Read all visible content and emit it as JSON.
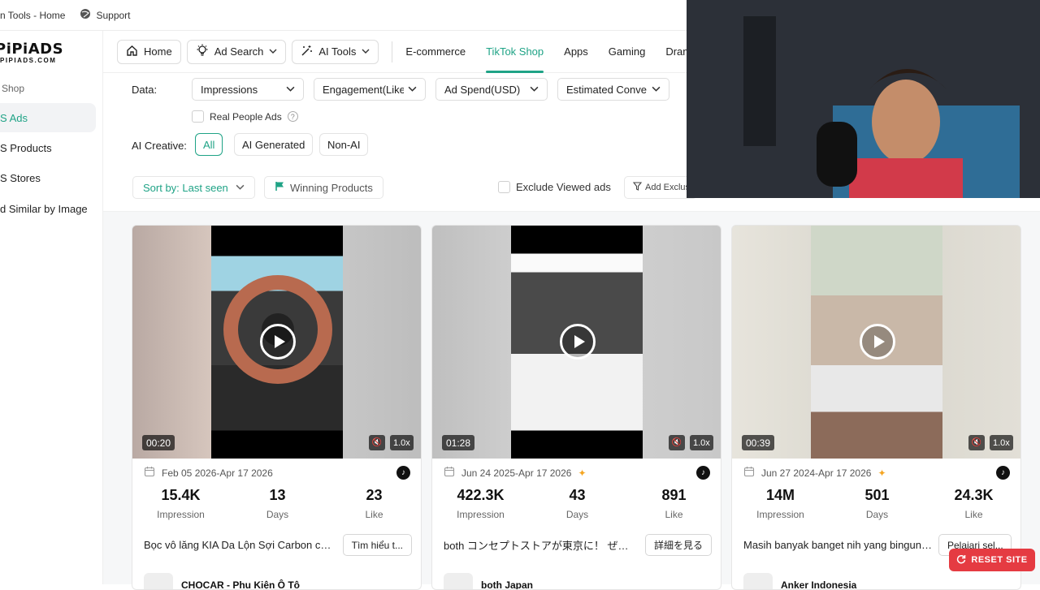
{
  "topbar": {
    "tools_link": "n Tools - Home",
    "support_link": "Support"
  },
  "logo": {
    "line1": "PiPiADS",
    "line2": "PIPIADS.COM"
  },
  "sidebar": {
    "group_label": "Shop",
    "items": [
      {
        "label": "S Ads",
        "active": true
      },
      {
        "label": "S Products",
        "active": false
      },
      {
        "label": "S Stores",
        "active": false
      },
      {
        "label": "d Similar by Image",
        "active": false
      }
    ]
  },
  "nav": {
    "home": "Home",
    "ad_search": "Ad Search",
    "ai_tools": "AI Tools",
    "links": [
      "E-commerce",
      "TikTok Shop",
      "Apps",
      "Gaming",
      "Drama"
    ],
    "active_link": "TikTok Shop"
  },
  "filters": {
    "data_label": "Data:",
    "dropdowns": [
      "Impressions",
      "Engagement(Like",
      "Ad Spend(USD)",
      "Estimated Conve"
    ],
    "real_people": "Real People Ads",
    "ai_creative_label": "AI Creative:",
    "ai_options": [
      "All",
      "AI Generated",
      "Non-AI"
    ],
    "sort_by": "Sort by: Last seen",
    "winning": "Winning Products",
    "exclude_viewed": "Exclude Viewed ads",
    "add_exclusion": "Add Exclus"
  },
  "cards": [
    {
      "duration": "00:20",
      "speed": "1.0x",
      "date_range": "Feb 05 2026-Apr 17 2026",
      "sparkle": false,
      "stats": [
        {
          "value": "15.4K",
          "label": "Impression"
        },
        {
          "value": "13",
          "label": "Days"
        },
        {
          "value": "23",
          "label": "Like"
        }
      ],
      "description": "Bọc vô lăng KIA Da Lộn Sợi Carbon cá t...",
      "cta": "Tìm hiểu t...",
      "advertiser": "CHOCAR - Phụ Kiện Ô Tô"
    },
    {
      "duration": "01:28",
      "speed": "1.0x",
      "date_range": "Jun 24 2025-Apr 17 2026",
      "sparkle": true,
      "stats": [
        {
          "value": "422.3K",
          "label": "Impression"
        },
        {
          "value": "43",
          "label": "Days"
        },
        {
          "value": "891",
          "label": "Like"
        }
      ],
      "description": "both コンセプトストアが東京に！ ぜひ...",
      "cta": "詳細を見る",
      "advertiser": "both Japan"
    },
    {
      "duration": "00:39",
      "speed": "1.0x",
      "date_range": "Jun 27 2024-Apr 17 2026",
      "sparkle": true,
      "stats": [
        {
          "value": "14M",
          "label": "Impression"
        },
        {
          "value": "501",
          "label": "Days"
        },
        {
          "value": "24.3K",
          "label": "Like"
        }
      ],
      "description": "Masih banyak banget nih yang bingung...",
      "cta": "Pelajari sel...",
      "advertiser": "Anker Indonesia"
    }
  ],
  "reset_button": "RESET SITE",
  "colors": {
    "accent": "#1fa386",
    "reset": "#e53b42"
  }
}
